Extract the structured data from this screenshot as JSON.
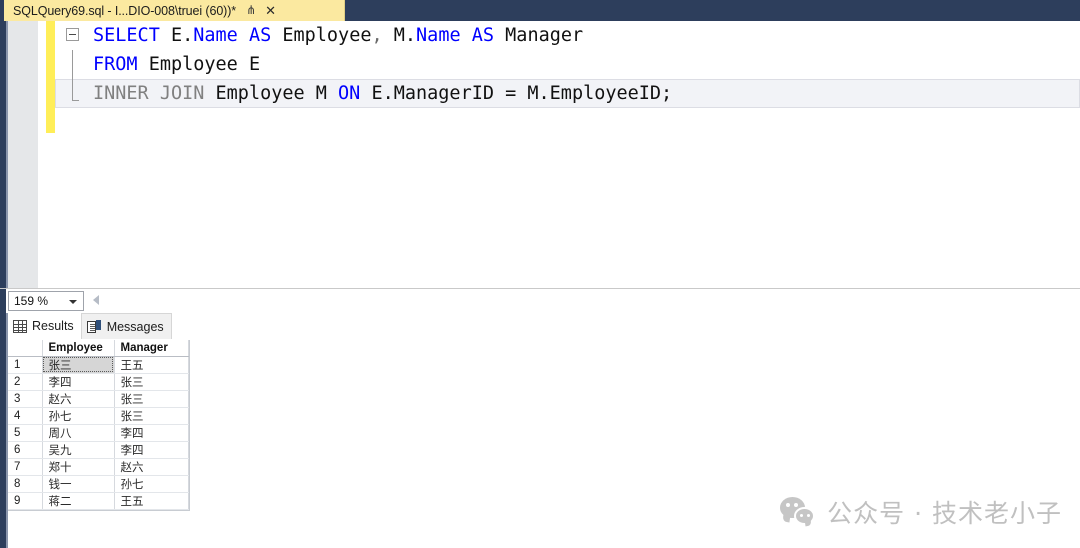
{
  "window": {
    "tab": {
      "title": "SQLQuery69.sql - I...DIO-008\\truei (60))*",
      "pin_icon": "pin-icon",
      "close_icon": "close-icon"
    }
  },
  "editor": {
    "lines": [
      {
        "tokens": [
          {
            "t": "SELECT",
            "c": "kw"
          },
          {
            "t": " E.",
            "c": ""
          },
          {
            "t": "Name",
            "c": "kw"
          },
          {
            "t": " ",
            "c": ""
          },
          {
            "t": "AS",
            "c": "kw"
          },
          {
            "t": " Employee",
            "c": ""
          },
          {
            "t": ",",
            "c": "punct"
          },
          {
            "t": " M.",
            "c": ""
          },
          {
            "t": "Name",
            "c": "kw"
          },
          {
            "t": " ",
            "c": ""
          },
          {
            "t": "AS",
            "c": "kw"
          },
          {
            "t": " Manager",
            "c": ""
          }
        ]
      },
      {
        "tokens": [
          {
            "t": "FROM",
            "c": "kw"
          },
          {
            "t": " Employee E",
            "c": ""
          }
        ]
      },
      {
        "tokens": [
          {
            "t": "INNER JOIN",
            "c": "gray"
          },
          {
            "t": " Employee M ",
            "c": ""
          },
          {
            "t": "ON",
            "c": "kw"
          },
          {
            "t": " E.ManagerID = M.EmployeeID;",
            "c": ""
          }
        ]
      }
    ],
    "outline_collapse_icon": "collapse-minus-icon"
  },
  "zoombar": {
    "zoom_value": "159 %",
    "dropdown_icon": "chevron-down-icon",
    "scroll_left_icon": "scroll-left-arrow-icon"
  },
  "results_pane": {
    "tabs": [
      {
        "label": "Results",
        "icon": "grid-icon",
        "active": true
      },
      {
        "label": "Messages",
        "icon": "messages-icon",
        "active": false
      }
    ],
    "grid": {
      "columns": [
        "",
        "Employee",
        "Manager"
      ],
      "rows": [
        {
          "n": "1",
          "employee": "张三",
          "manager": "王五",
          "selected": true
        },
        {
          "n": "2",
          "employee": "李四",
          "manager": "张三",
          "selected": false
        },
        {
          "n": "3",
          "employee": "赵六",
          "manager": "张三",
          "selected": false
        },
        {
          "n": "4",
          "employee": "孙七",
          "manager": "张三",
          "selected": false
        },
        {
          "n": "5",
          "employee": "周八",
          "manager": "李四",
          "selected": false
        },
        {
          "n": "6",
          "employee": "吴九",
          "manager": "李四",
          "selected": false
        },
        {
          "n": "7",
          "employee": "郑十",
          "manager": "赵六",
          "selected": false
        },
        {
          "n": "8",
          "employee": "钱一",
          "manager": "孙七",
          "selected": false
        },
        {
          "n": "9",
          "employee": "蒋二",
          "manager": "王五",
          "selected": false
        }
      ]
    }
  },
  "watermark": {
    "icon": "wechat-icon",
    "text": "公众号 · 技术老小子"
  },
  "colors": {
    "chrome": "#2d3e5c",
    "tab_active": "#fbe9a0",
    "keyword": "#0000ff",
    "change_bar": "#ffee58",
    "selected_cell": "#d6d6d6"
  }
}
